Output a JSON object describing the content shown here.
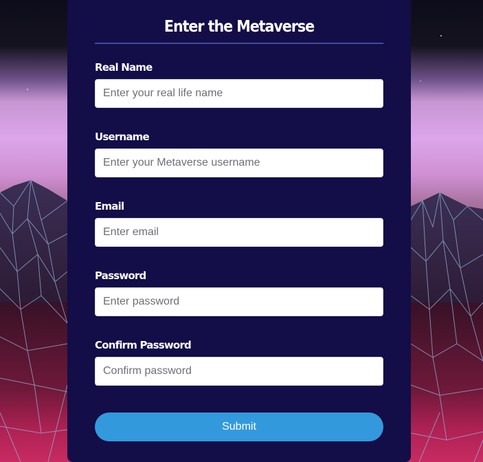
{
  "form": {
    "title": "Enter the Metaverse",
    "fields": [
      {
        "label": "Real Name",
        "placeholder": "Enter your real life name",
        "type": "text"
      },
      {
        "label": "Username",
        "placeholder": "Enter your Metaverse username",
        "type": "text"
      },
      {
        "label": "Email",
        "placeholder": "Enter email",
        "type": "email"
      },
      {
        "label": "Password",
        "placeholder": "Enter password",
        "type": "password"
      },
      {
        "label": "Confirm Password",
        "placeholder": "Confirm password",
        "type": "password"
      }
    ],
    "submit_label": "Submit"
  },
  "theme": {
    "panel_color": "#130d48",
    "accent_color": "#3399dd",
    "rule_color": "#3d4f9c"
  },
  "background": {
    "description_icon": "synthwave-wireframe-mountains"
  }
}
